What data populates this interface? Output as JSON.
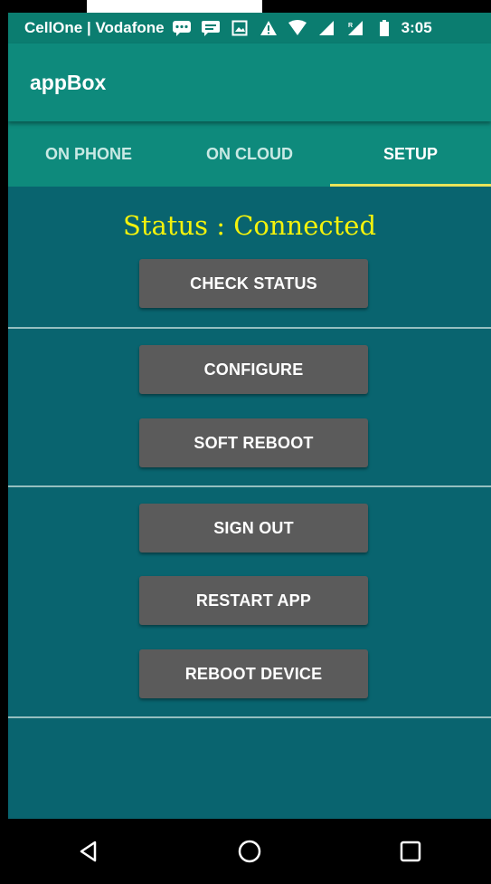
{
  "status_bar": {
    "carrier": "CellOne | Vodafone",
    "time": "3:05",
    "icons": [
      "chat-icon",
      "message-icon",
      "image-icon",
      "warning-icon",
      "wifi-icon",
      "signal-icon",
      "roaming-signal-icon",
      "battery-icon"
    ]
  },
  "app_bar": {
    "title": "appBox"
  },
  "tabs": [
    {
      "label": "ON PHONE"
    },
    {
      "label": "ON CLOUD"
    },
    {
      "label": "SETUP"
    }
  ],
  "content": {
    "status": "Status : Connected",
    "buttons": {
      "check_status": "CHECK STATUS",
      "configure": "CONFIGURE",
      "soft_reboot": "SOFT REBOOT",
      "sign_out": "SIGN OUT",
      "restart_app": "RESTART APP",
      "reboot_device": "REBOOT DEVICE"
    }
  },
  "nav": {
    "icons": [
      "back-icon",
      "home-icon",
      "recents-icon"
    ]
  },
  "colors": {
    "accent": "#0e8a7c",
    "content_bg": "#09646f",
    "status_text": "#f3f20c",
    "tab_indicator": "#e8e45a",
    "button": "#5b5b5b"
  }
}
